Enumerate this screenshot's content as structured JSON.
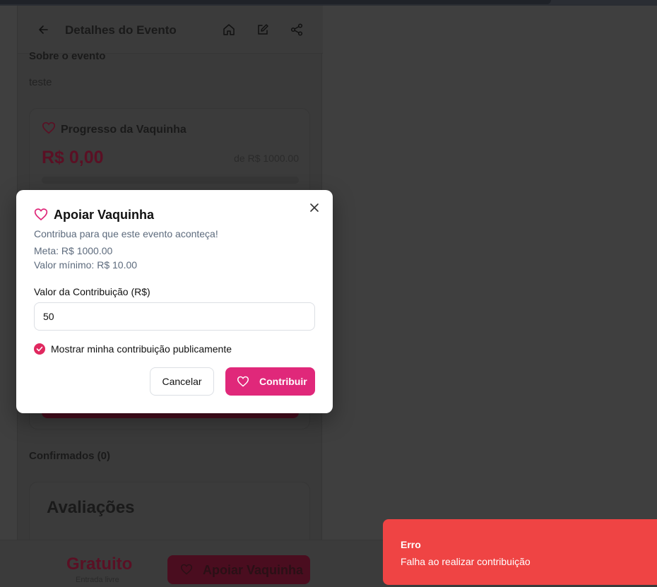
{
  "header": {
    "title": "Detalhes do Evento",
    "icons": [
      "back-arrow-icon",
      "home-icon",
      "edit-icon",
      "share-icon"
    ]
  },
  "about": {
    "title": "Sobre o evento",
    "text": "teste"
  },
  "vaquinha_card": {
    "title": "Progresso da Vaquinha",
    "raised": "R$ 0,00",
    "goal": "de R$ 1000.00",
    "progress": 0
  },
  "confirmed": "Confirmados (0)",
  "reviews": {
    "title": "Avaliações"
  },
  "bottom_bar": {
    "price": "Gratuito",
    "price_sub": "Entrada livre",
    "support_button": "Apoiar Vaquinha"
  },
  "modal": {
    "title": "Apoiar Vaquinha",
    "description": "Contribua para que este evento aconteça!",
    "goal": "Meta: R$ 1000.00",
    "minimum": "Valor mínimo: R$ 10.00",
    "field_label": "Valor da Contribuição (R$)",
    "amount_value": "50",
    "public_checkbox": {
      "label": "Mostrar minha contribuição publicamente",
      "checked": true
    },
    "cancel_label": "Cancelar",
    "contribute_label": "Contribuir"
  },
  "toast": {
    "title": "Erro",
    "message": "Falha ao realizar contribuição"
  },
  "colors": {
    "accent": "#e0287a",
    "error": "#ef4444",
    "overlay": "#3f3f3f"
  }
}
